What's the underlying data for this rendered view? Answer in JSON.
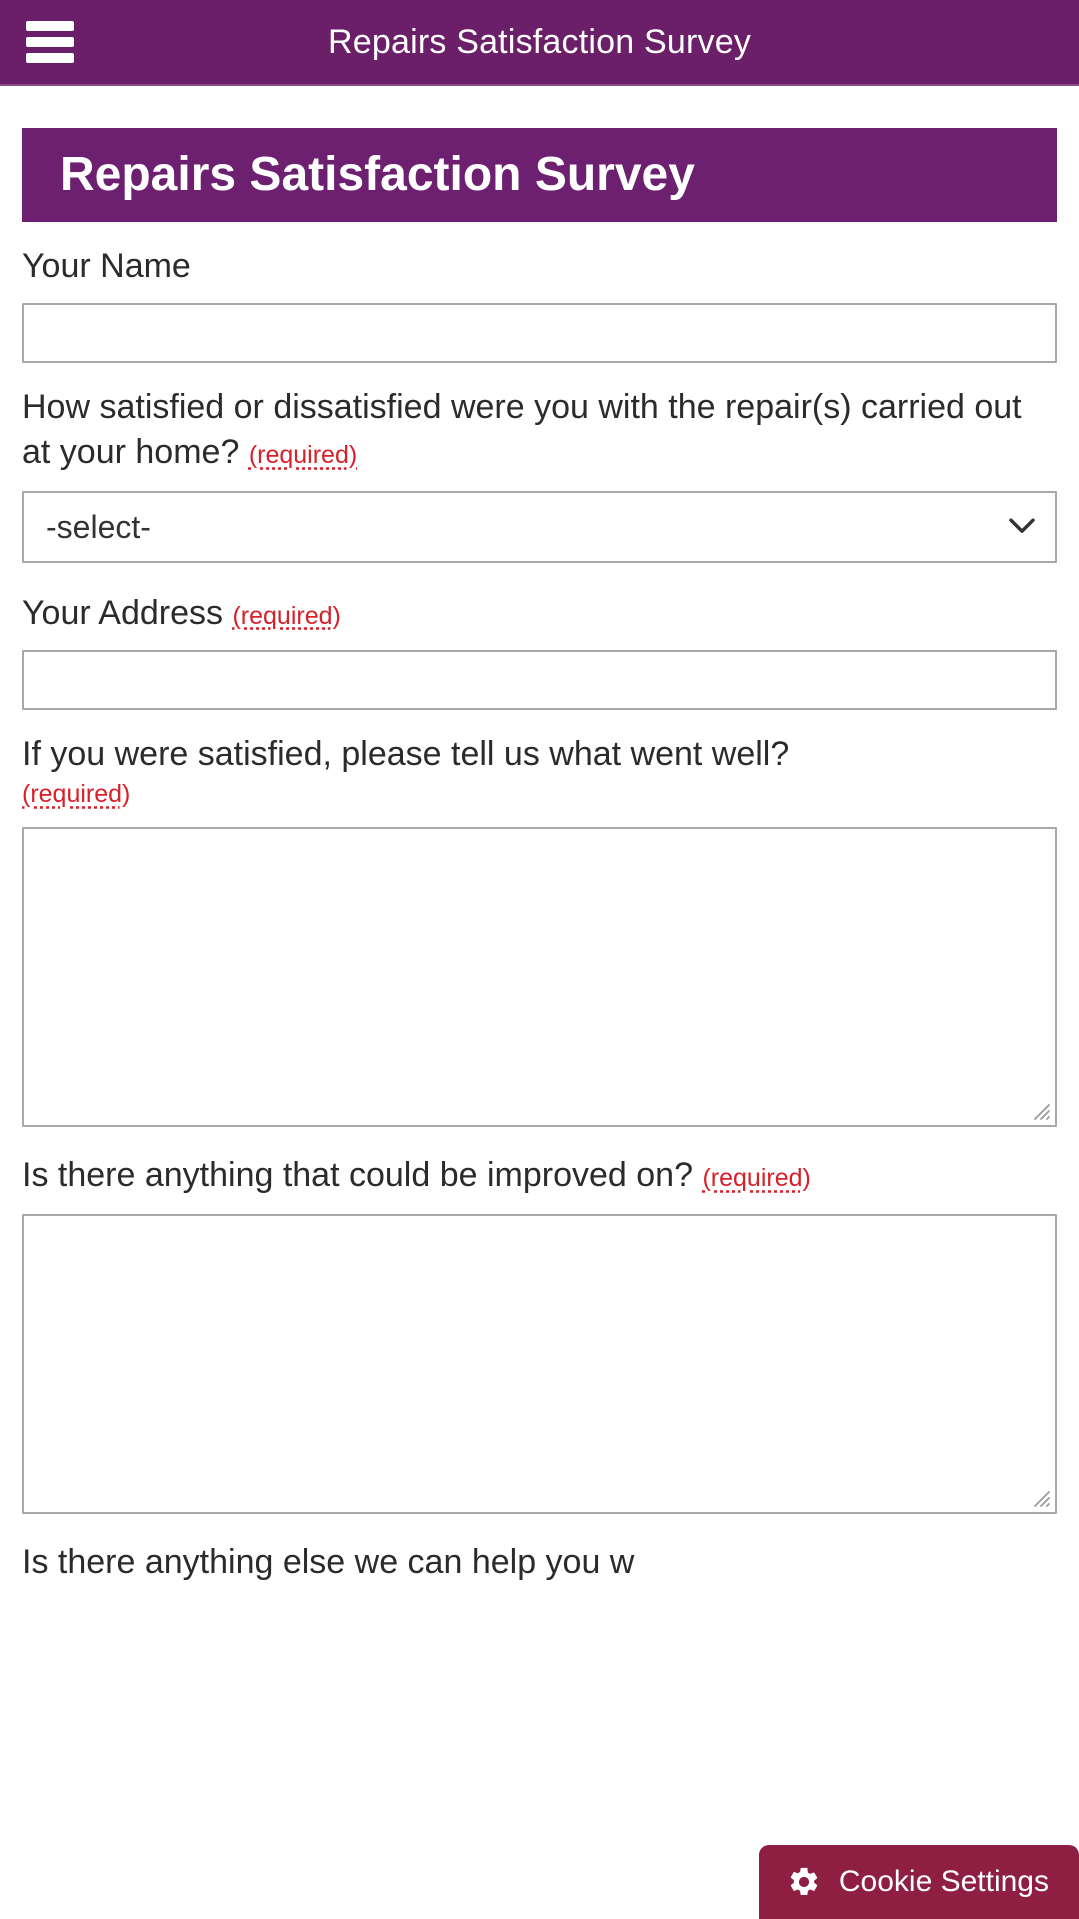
{
  "appbar": {
    "menu_icon": "hamburger-menu-icon",
    "title": "Repairs Satisfaction Survey"
  },
  "banner": {
    "title": "Repairs Satisfaction Survey"
  },
  "colors": {
    "brand_purple": "#6B1F68",
    "banner_purple": "#6D1F70",
    "required_red": "#d6202a",
    "cookie_maroon": "#8E1E42",
    "field_border": "#a8a8a8"
  },
  "form": {
    "required_marker": "(required)",
    "fields": [
      {
        "id": "your-name",
        "label": "Your Name",
        "required": false,
        "type": "text",
        "value": "",
        "placeholder": ""
      },
      {
        "id": "satisfaction",
        "label": "How satisfied or dissatisfied were you with the repair(s) carried out at your home?",
        "required": true,
        "type": "select",
        "selected": "-select-",
        "options": [
          "-select-"
        ]
      },
      {
        "id": "your-address",
        "label": "Your Address",
        "required": true,
        "type": "text",
        "value": "",
        "placeholder": ""
      },
      {
        "id": "what-went-well",
        "label": "If you were satisfied, please tell us what went well?",
        "required": true,
        "type": "textarea",
        "value": "",
        "placeholder": ""
      },
      {
        "id": "improvements",
        "label": "Is there anything that could be improved on?",
        "required": true,
        "type": "textarea",
        "value": "",
        "placeholder": ""
      },
      {
        "id": "anything-else",
        "label": "Is there anything else we can help you w",
        "required": false,
        "type": "label-only",
        "value": "",
        "placeholder": ""
      }
    ]
  },
  "cookie": {
    "icon": "gear-icon",
    "label": "Cookie Settings"
  }
}
